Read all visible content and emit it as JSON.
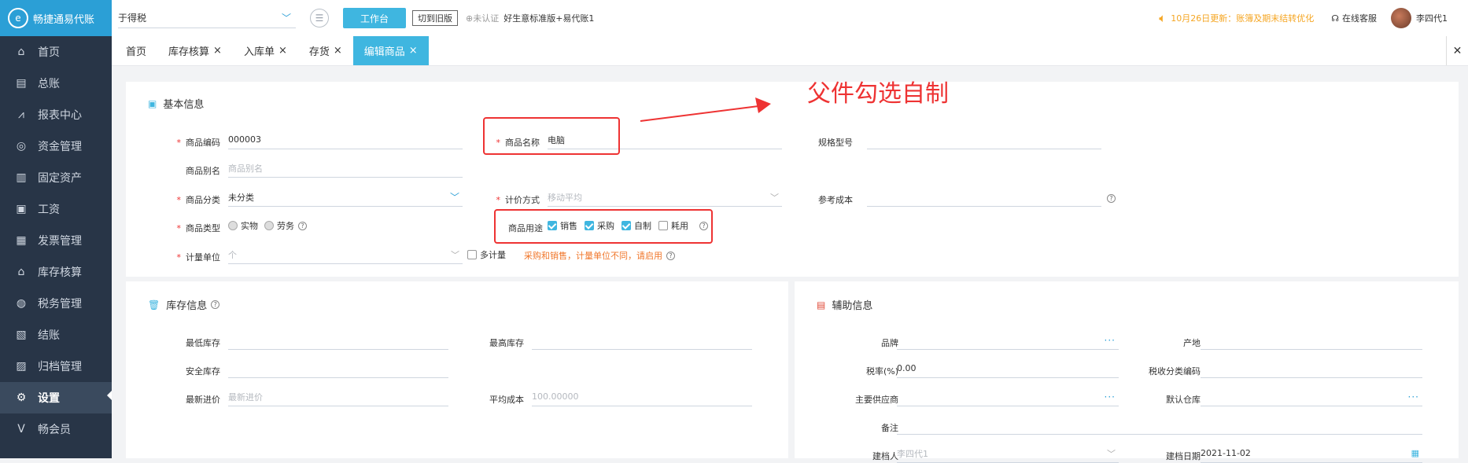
{
  "app": {
    "logo_text": "畅捷通易代账",
    "logo_mark": "e"
  },
  "sidebar": {
    "items": [
      {
        "label": "首页",
        "icon": "home-icon",
        "glyph": "⌂"
      },
      {
        "label": "总账",
        "icon": "ledger-icon",
        "glyph": "▤"
      },
      {
        "label": "报表中心",
        "icon": "chart-icon",
        "glyph": "⩘"
      },
      {
        "label": "资金管理",
        "icon": "money-icon",
        "glyph": "◎"
      },
      {
        "label": "固定资产",
        "icon": "asset-icon",
        "glyph": "▥"
      },
      {
        "label": "工资",
        "icon": "salary-icon",
        "glyph": "▣"
      },
      {
        "label": "发票管理",
        "icon": "invoice-icon",
        "glyph": "▦"
      },
      {
        "label": "库存核算",
        "icon": "warehouse-icon",
        "glyph": "⌂"
      },
      {
        "label": "税务管理",
        "icon": "tax-icon",
        "glyph": "◍"
      },
      {
        "label": "结账",
        "icon": "close-book-icon",
        "glyph": "▧"
      },
      {
        "label": "归档管理",
        "icon": "archive-icon",
        "glyph": "▨"
      },
      {
        "label": "设置",
        "icon": "gear-icon",
        "glyph": "⚙"
      },
      {
        "label": "畅会员",
        "icon": "vip-icon",
        "glyph": "V"
      }
    ],
    "active_index": 11
  },
  "topbar": {
    "company": "于得税",
    "workbench_label": "工作台",
    "switch_label": "切到旧版",
    "unverified": "未认证",
    "edition": "好生意标准版+易代账1",
    "notice": "10月26日更新：账簿及期末结转优化",
    "customer_service": "在线客服",
    "username": "李四代1"
  },
  "tabs": [
    {
      "label": "首页",
      "closable": false
    },
    {
      "label": "库存核算",
      "closable": true
    },
    {
      "label": "入库单",
      "closable": true
    },
    {
      "label": "存货",
      "closable": true
    },
    {
      "label": "编辑商品",
      "closable": true,
      "active": true
    }
  ],
  "basic": {
    "title": "基本信息",
    "code_label": "商品编码",
    "code_value": "000003",
    "name_label": "商品名称",
    "name_value": "电脑",
    "spec_label": "规格型号",
    "alias_label": "商品别名",
    "alias_placeholder": "商品别名",
    "category_label": "商品分类",
    "category_value": "未分类",
    "pricing_label": "计价方式",
    "pricing_value": "移动平均",
    "refcost_label": "参考成本",
    "type_label": "商品类型",
    "type_options": [
      "实物",
      "劳务"
    ],
    "usage_label": "商品用途",
    "usage_options": [
      {
        "label": "销售",
        "checked": true
      },
      {
        "label": "采购",
        "checked": true
      },
      {
        "label": "自制",
        "checked": true
      },
      {
        "label": "耗用",
        "checked": false
      }
    ],
    "unit_label": "计量单位",
    "unit_placeholder": "个",
    "multi_unit_label": "多计量",
    "multi_unit_hint": "采购和销售，计量单位不同，请启用"
  },
  "stock": {
    "title": "库存信息",
    "min_label": "最低库存",
    "max_label": "最高库存",
    "safe_label": "安全库存",
    "last_price_label": "最新进价",
    "last_price_placeholder": "最新进价",
    "avg_cost_label": "平均成本",
    "avg_cost_value": "100.00000"
  },
  "aux": {
    "title": "辅助信息",
    "brand_label": "品牌",
    "origin_label": "产地",
    "tax_rate_label": "税率(%)",
    "tax_rate_value": "0.00",
    "tax_code_label": "税收分类编码",
    "supplier_label": "主要供应商",
    "warehouse_label": "默认仓库",
    "remark_label": "备注",
    "creator_label": "建档人",
    "creator_value": "李四代1",
    "created_label": "建档日期",
    "created_value": "2021-11-02"
  },
  "annotation": {
    "text": "父件勾选自制",
    "color": "#e33333"
  }
}
